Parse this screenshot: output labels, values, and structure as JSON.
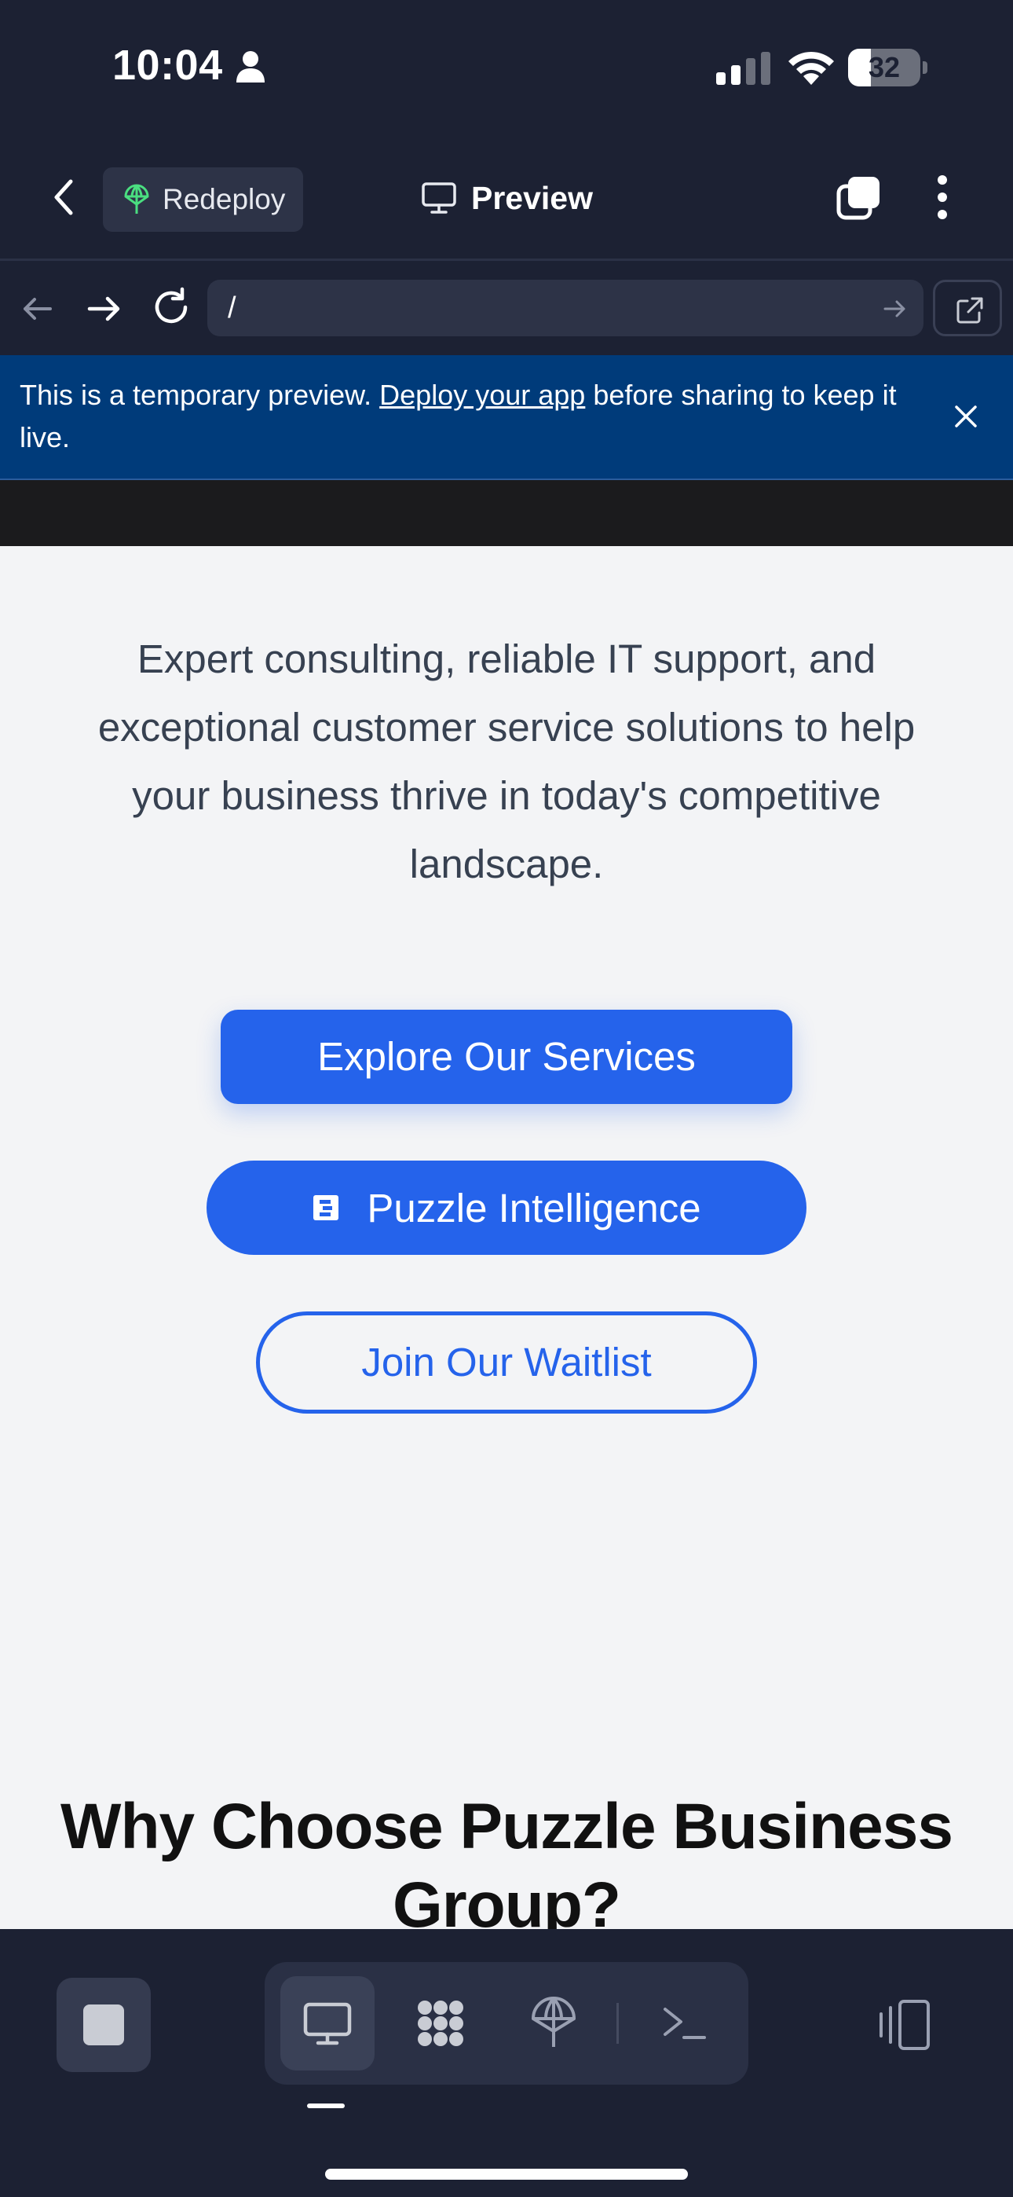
{
  "status_bar": {
    "time": "10:04",
    "battery": "32",
    "battery_level": 0.32
  },
  "header": {
    "redeploy_label": "Redeploy",
    "title": "Preview"
  },
  "url_bar": {
    "url": "/"
  },
  "banner": {
    "text_before": "This is a temporary preview. ",
    "link": "Deploy your app",
    "text_after": " before sharing to keep it live."
  },
  "page": {
    "tagline": "Expert consulting, reliable IT support, and exceptional customer service solutions to help your business thrive in today's competitive landscape.",
    "primary_button": "Explore Our Services",
    "intelligence_button": "Puzzle Intelligence",
    "waitlist_button": "Join Our Waitlist",
    "section_title": "Why Choose Puzzle Business Group?"
  },
  "colors": {
    "app_bg": "#1c2133",
    "banner_bg": "#003b7a",
    "accent_blue": "#2563eb",
    "page_bg": "#f3f4f6"
  },
  "toolbar": {
    "icons": [
      "stop-icon",
      "preview-monitor-icon",
      "workspace-grid-icon",
      "deploy-icon",
      "shell-icon",
      "panels-icon"
    ]
  }
}
